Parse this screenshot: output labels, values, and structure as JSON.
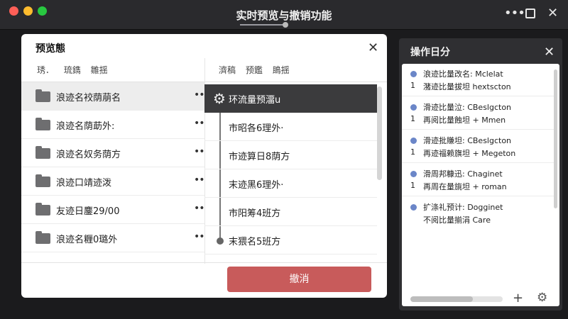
{
  "window": {
    "title": "实时预览与撤销功能",
    "controls": {
      "more": "•••",
      "close": "✕"
    },
    "title_progress": 0.92
  },
  "dialog": {
    "title": "预览態",
    "close": "✕",
    "left_header": "琇． 琉鐫 雛揺",
    "right_header": "濟稿 预鑑 鴡揺",
    "left_rows": [
      {
        "label": "浪迹名䘨荫萠名",
        "dots": "••"
      },
      {
        "label": "浪迹名荫莇外:",
        "dots": "••"
      },
      {
        "label": "浪迹名奴务荫方",
        "dots": "••"
      },
      {
        "label": "浪迹口靖迹泼",
        "dots": "••"
      },
      {
        "label": "友迹日鏖29/00",
        "dots": "••"
      },
      {
        "label": "浪迹名糎0璐外",
        "dots": "••"
      }
    ],
    "right_rows": [
      {
        "label": "环流量预澑u"
      },
      {
        "label": "市昭各6理外·"
      },
      {
        "label": "市迹算日8荫方"
      },
      {
        "label": "末迹黑6理外·"
      },
      {
        "label": "市阳筹4班方"
      },
      {
        "label": "末猥名5班方"
      }
    ],
    "cancel_label": "撤消"
  },
  "panel": {
    "title": "操作日分",
    "close": "✕",
    "items": [
      {
        "line1": "浪迹比量改名: Mclelat",
        "num": "1",
        "line2": "潴迹比量拔坦 hextscton"
      },
      {
        "line1": "滑迹比量泣: CBeslgcton",
        "num": "1",
        "line2": "再阅比量蝕坦 + Mmen"
      },
      {
        "line1": "滑迹批賺坦: CBeslgcton",
        "num": "1",
        "line2": "再迹福赖旗坦 + Megeton"
      },
      {
        "line1": "滑周邦糠迅: Chaginet",
        "num": "1",
        "line2": "再周在量旐坦 + roman"
      },
      {
        "line1": "扩涤礼预计: Dogginet",
        "num": "",
        "line2": "不阅比量揃涓 Care"
      }
    ],
    "add": "+",
    "progress": 0.68
  },
  "icons": {
    "folder": "folder-icon",
    "gear": "gear-icon",
    "more": "more-horizontal-icon",
    "maximize": "maximize-icon",
    "close": "close-icon",
    "add": "plus-icon",
    "settings": "settings-icon"
  },
  "colors": {
    "accent_cancel": "#c85b5b",
    "bullet": "#6b86c8",
    "highlight_row": "#3b3b3d"
  }
}
